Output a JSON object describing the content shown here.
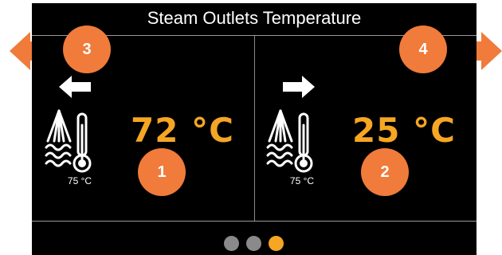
{
  "screen": {
    "title": "Steam Outlets Temperature"
  },
  "outlets": [
    {
      "temperature": "72 °C",
      "setpoint": "75 °C",
      "arrow_icon": "arrow-left-icon",
      "badge": "1"
    },
    {
      "temperature": "25 °C",
      "setpoint": "75 °C",
      "arrow_icon": "arrow-right-icon",
      "badge": "2"
    }
  ],
  "navigation": {
    "prev_badge": "3",
    "next_badge": "4"
  },
  "pagination": {
    "pages": 3,
    "active_index": 2
  },
  "colors": {
    "accent": "#f5a623",
    "callout": "#f07b3a",
    "dot_inactive": "#8a8a8a",
    "background": "#000000"
  }
}
